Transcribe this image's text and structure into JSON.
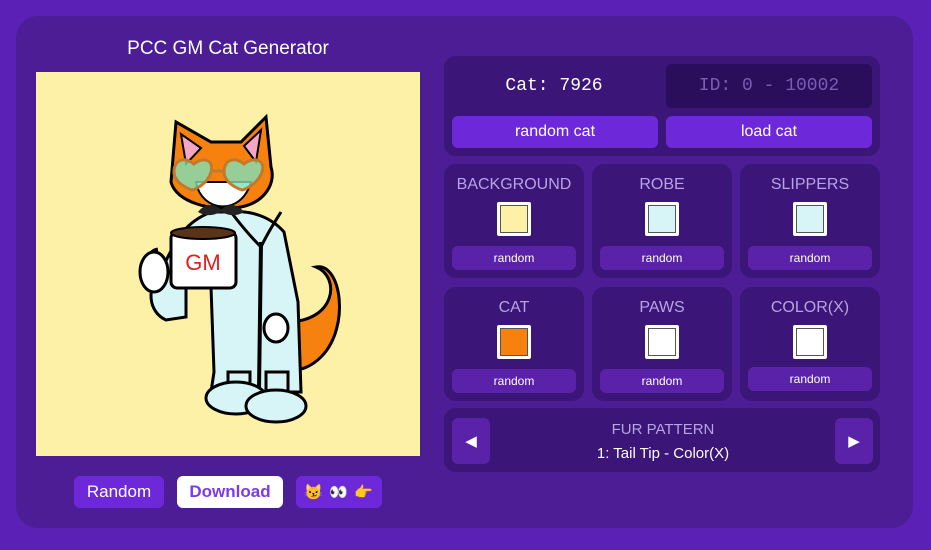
{
  "app": {
    "title": "PCC GM Cat Generator"
  },
  "preview": {
    "mug_text": "GM",
    "background_color": "#fdf1a8"
  },
  "actions": {
    "random": "Random",
    "download": "Download",
    "emoji": "😼 👀 👉"
  },
  "selector": {
    "cat_label": "Cat: 7926",
    "id_placeholder": "ID: 0 - 10002",
    "random_cat": "random cat",
    "load_cat": "load cat"
  },
  "colors": {
    "background": {
      "label": "BACKGROUND",
      "color": "#fdf1a8",
      "random": "random"
    },
    "robe": {
      "label": "ROBE",
      "color": "#d7f4f7",
      "random": "random"
    },
    "slippers": {
      "label": "SLIPPERS",
      "color": "#d7f4f7",
      "random": "random"
    },
    "cat": {
      "label": "CAT",
      "color": "#f7810f",
      "random": "random"
    },
    "paws": {
      "label": "PAWS",
      "color": "#ffffff",
      "random": "random"
    },
    "colorx": {
      "label": "COLOR(X)",
      "color": "#ffffff",
      "random": "random"
    }
  },
  "fur": {
    "label": "FUR PATTERN",
    "value": "1: Tail Tip - Color(X)",
    "prev": "◀",
    "next": "▶"
  },
  "icons": {
    "prev": "caret-left-icon",
    "next": "caret-right-icon"
  }
}
